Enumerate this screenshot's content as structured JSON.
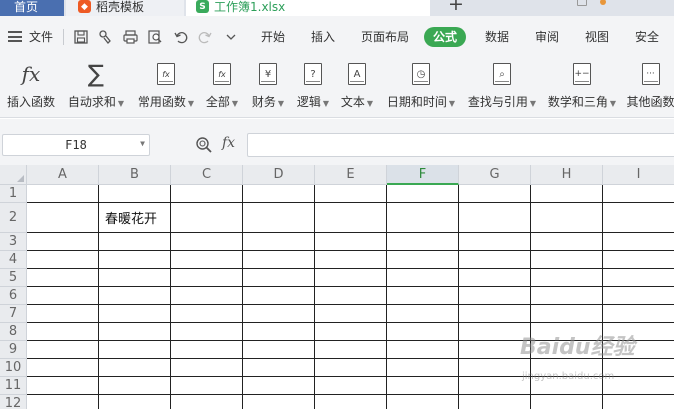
{
  "tabs": {
    "home": "首页",
    "shell": "稻壳模板",
    "file": "工作簿1.xlsx"
  },
  "menu": {
    "file": "文件",
    "items": [
      "开始",
      "插入",
      "页面布局",
      "公式",
      "数据",
      "审阅",
      "视图",
      "安全"
    ],
    "active": "公式"
  },
  "ribbon": {
    "insert_function": "插入函数",
    "autosum": "自动求和",
    "common": "常用函数",
    "all": "全部",
    "finance": "财务",
    "logic": "逻辑",
    "text": "文本",
    "datetime": "日期和时间",
    "lookup": "查找与引用",
    "math": "数学和三角",
    "other": "其他函数",
    "icon_logic": "?",
    "icon_text": "A",
    "icon_finance": "¥"
  },
  "formula_bar": {
    "name_box": "F18",
    "fx": "fx",
    "value": ""
  },
  "grid": {
    "columns": [
      "A",
      "B",
      "C",
      "D",
      "E",
      "F",
      "G",
      "H",
      "I"
    ],
    "selected_column": "F",
    "rows": [
      "1",
      "2",
      "3",
      "4",
      "5",
      "6",
      "7",
      "8",
      "9",
      "10",
      "11",
      "12"
    ],
    "cells": {
      "B2": "春暖花开"
    }
  },
  "watermark": {
    "logo": "Baidu经验",
    "url": "jingyan.baidu.com"
  },
  "colors": {
    "accent": "#3aa853",
    "tab_home": "#4a6fb0",
    "badge_orange": "#ee5a24"
  }
}
